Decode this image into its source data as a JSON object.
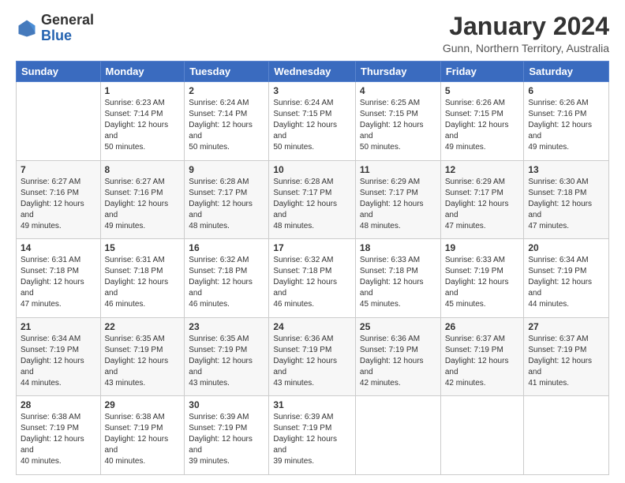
{
  "header": {
    "logo": {
      "line1": "General",
      "line2": "Blue"
    },
    "title": "January 2024",
    "location": "Gunn, Northern Territory, Australia"
  },
  "weekdays": [
    "Sunday",
    "Monday",
    "Tuesday",
    "Wednesday",
    "Thursday",
    "Friday",
    "Saturday"
  ],
  "weeks": [
    [
      null,
      {
        "day": 1,
        "sunrise": "6:23 AM",
        "sunset": "7:14 PM",
        "daylight": "12 hours and 50 minutes."
      },
      {
        "day": 2,
        "sunrise": "6:24 AM",
        "sunset": "7:14 PM",
        "daylight": "12 hours and 50 minutes."
      },
      {
        "day": 3,
        "sunrise": "6:24 AM",
        "sunset": "7:15 PM",
        "daylight": "12 hours and 50 minutes."
      },
      {
        "day": 4,
        "sunrise": "6:25 AM",
        "sunset": "7:15 PM",
        "daylight": "12 hours and 50 minutes."
      },
      {
        "day": 5,
        "sunrise": "6:26 AM",
        "sunset": "7:15 PM",
        "daylight": "12 hours and 49 minutes."
      },
      {
        "day": 6,
        "sunrise": "6:26 AM",
        "sunset": "7:16 PM",
        "daylight": "12 hours and 49 minutes."
      }
    ],
    [
      {
        "day": 7,
        "sunrise": "6:27 AM",
        "sunset": "7:16 PM",
        "daylight": "12 hours and 49 minutes."
      },
      {
        "day": 8,
        "sunrise": "6:27 AM",
        "sunset": "7:16 PM",
        "daylight": "12 hours and 49 minutes."
      },
      {
        "day": 9,
        "sunrise": "6:28 AM",
        "sunset": "7:17 PM",
        "daylight": "12 hours and 48 minutes."
      },
      {
        "day": 10,
        "sunrise": "6:28 AM",
        "sunset": "7:17 PM",
        "daylight": "12 hours and 48 minutes."
      },
      {
        "day": 11,
        "sunrise": "6:29 AM",
        "sunset": "7:17 PM",
        "daylight": "12 hours and 48 minutes."
      },
      {
        "day": 12,
        "sunrise": "6:29 AM",
        "sunset": "7:17 PM",
        "daylight": "12 hours and 47 minutes."
      },
      {
        "day": 13,
        "sunrise": "6:30 AM",
        "sunset": "7:18 PM",
        "daylight": "12 hours and 47 minutes."
      }
    ],
    [
      {
        "day": 14,
        "sunrise": "6:31 AM",
        "sunset": "7:18 PM",
        "daylight": "12 hours and 47 minutes."
      },
      {
        "day": 15,
        "sunrise": "6:31 AM",
        "sunset": "7:18 PM",
        "daylight": "12 hours and 46 minutes."
      },
      {
        "day": 16,
        "sunrise": "6:32 AM",
        "sunset": "7:18 PM",
        "daylight": "12 hours and 46 minutes."
      },
      {
        "day": 17,
        "sunrise": "6:32 AM",
        "sunset": "7:18 PM",
        "daylight": "12 hours and 46 minutes."
      },
      {
        "day": 18,
        "sunrise": "6:33 AM",
        "sunset": "7:18 PM",
        "daylight": "12 hours and 45 minutes."
      },
      {
        "day": 19,
        "sunrise": "6:33 AM",
        "sunset": "7:19 PM",
        "daylight": "12 hours and 45 minutes."
      },
      {
        "day": 20,
        "sunrise": "6:34 AM",
        "sunset": "7:19 PM",
        "daylight": "12 hours and 44 minutes."
      }
    ],
    [
      {
        "day": 21,
        "sunrise": "6:34 AM",
        "sunset": "7:19 PM",
        "daylight": "12 hours and 44 minutes."
      },
      {
        "day": 22,
        "sunrise": "6:35 AM",
        "sunset": "7:19 PM",
        "daylight": "12 hours and 43 minutes."
      },
      {
        "day": 23,
        "sunrise": "6:35 AM",
        "sunset": "7:19 PM",
        "daylight": "12 hours and 43 minutes."
      },
      {
        "day": 24,
        "sunrise": "6:36 AM",
        "sunset": "7:19 PM",
        "daylight": "12 hours and 43 minutes."
      },
      {
        "day": 25,
        "sunrise": "6:36 AM",
        "sunset": "7:19 PM",
        "daylight": "12 hours and 42 minutes."
      },
      {
        "day": 26,
        "sunrise": "6:37 AM",
        "sunset": "7:19 PM",
        "daylight": "12 hours and 42 minutes."
      },
      {
        "day": 27,
        "sunrise": "6:37 AM",
        "sunset": "7:19 PM",
        "daylight": "12 hours and 41 minutes."
      }
    ],
    [
      {
        "day": 28,
        "sunrise": "6:38 AM",
        "sunset": "7:19 PM",
        "daylight": "12 hours and 40 minutes."
      },
      {
        "day": 29,
        "sunrise": "6:38 AM",
        "sunset": "7:19 PM",
        "daylight": "12 hours and 40 minutes."
      },
      {
        "day": 30,
        "sunrise": "6:39 AM",
        "sunset": "7:19 PM",
        "daylight": "12 hours and 39 minutes."
      },
      {
        "day": 31,
        "sunrise": "6:39 AM",
        "sunset": "7:19 PM",
        "daylight": "12 hours and 39 minutes."
      },
      null,
      null,
      null
    ]
  ]
}
